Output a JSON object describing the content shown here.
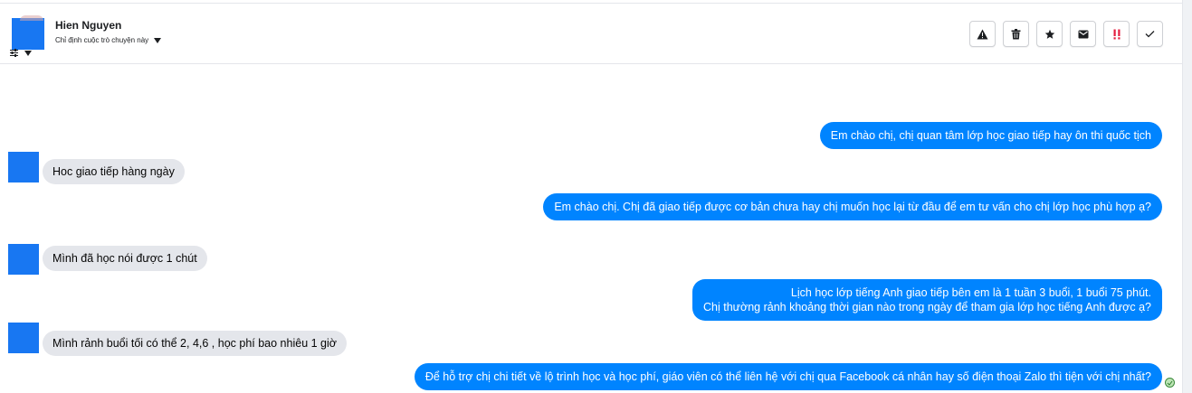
{
  "header": {
    "contact_name": "Hien Nguyen",
    "assign_label": "Chỉ định cuộc trò chuyện này"
  },
  "toolbar": {
    "buttons": [
      {
        "name": "report-spam",
        "icon": "warning-triangle-icon"
      },
      {
        "name": "delete",
        "icon": "trash-icon"
      },
      {
        "name": "star",
        "icon": "star-icon"
      },
      {
        "name": "mark-unread",
        "icon": "envelope-icon"
      },
      {
        "name": "mark-important",
        "icon": "double-exclamation-icon",
        "color": "#e41e3f"
      },
      {
        "name": "mark-done",
        "icon": "checkmark-icon"
      }
    ]
  },
  "colors": {
    "outgoing_bubble": "#0084ff",
    "incoming_bubble": "#e4e6eb",
    "avatar": "#1877f2"
  },
  "messages": [
    {
      "from": "page",
      "text": "Em chào chị, chị quan tâm lớp học giao tiếp hay ôn thi quốc tịch"
    },
    {
      "from": "customer",
      "text": "Hoc giao tiếp hàng ngày"
    },
    {
      "from": "page",
      "text": "Em chào chị. Chị đã giao tiếp được cơ bản chưa hay chị muốn học lại từ đầu để em tư vấn cho chị lớp học phù hợp ạ?"
    },
    {
      "from": "customer",
      "text": "Mình đã học nói được 1 chút"
    },
    {
      "from": "page",
      "lines": [
        "Lịch học lớp tiếng Anh giao tiếp bên em là 1 tuần 3 buổi, 1 buổi 75 phút.",
        "Chị thường rảnh khoảng thời gian nào trong ngày để tham gia lớp học tiếng Anh được ạ?"
      ]
    },
    {
      "from": "customer",
      "text": "Mình rảnh buổi tối có thể 2, 4,6 , học phí bao nhiêu 1 giờ"
    },
    {
      "from": "page",
      "text": "Để hỗ trợ chị chi tiết về lộ trình học và học phí, giáo viên có thể liên hệ với chị qua Facebook cá nhân hay số điện thoại Zalo thì tiện với chị nhất?"
    }
  ]
}
